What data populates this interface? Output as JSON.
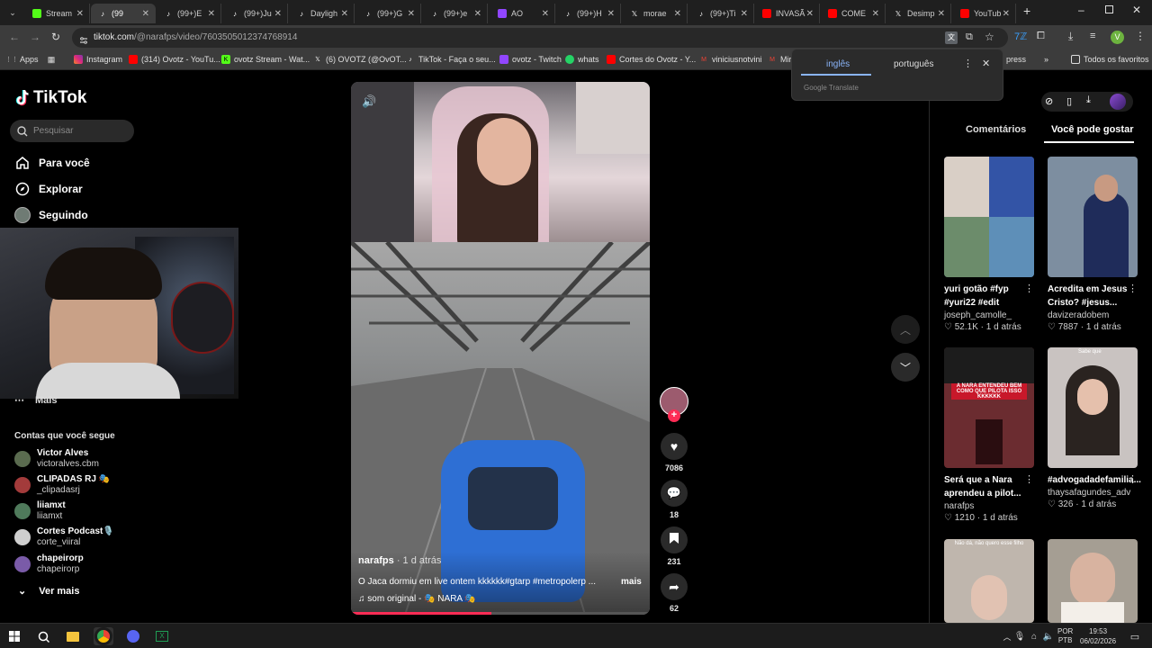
{
  "browser": {
    "tabs": [
      {
        "title": "Stream",
        "icon": "kick-icon",
        "color": "#53fc18"
      },
      {
        "title": "(99",
        "icon": "tiktok-icon",
        "color": "#ffffff",
        "active": true
      },
      {
        "title": "(99+)E",
        "icon": "tiktok-icon",
        "color": "#ffffff"
      },
      {
        "title": "(99+)Ju",
        "icon": "tiktok-icon",
        "color": "#ffffff"
      },
      {
        "title": "Dayligh",
        "icon": "tiktok-icon",
        "color": "#ffffff"
      },
      {
        "title": "(99+)G",
        "icon": "tiktok-icon",
        "color": "#ffffff"
      },
      {
        "title": "(99+)e",
        "icon": "tiktok-icon",
        "color": "#ffffff"
      },
      {
        "title": "AO",
        "icon": "twitch-icon",
        "color": "#9146ff"
      },
      {
        "title": "(99+)H",
        "icon": "tiktok-icon",
        "color": "#ffffff"
      },
      {
        "title": "morae",
        "icon": "x-icon",
        "color": "#ffffff"
      },
      {
        "title": "(99+)Ti",
        "icon": "tiktok-icon",
        "color": "#ffffff"
      },
      {
        "title": "INVASÃ",
        "icon": "youtube-icon",
        "color": "#ff0000"
      },
      {
        "title": "COME",
        "icon": "youtube-icon",
        "color": "#ff0000"
      },
      {
        "title": "Desimp",
        "icon": "x-icon",
        "color": "#ffffff"
      },
      {
        "title": "YouTub",
        "icon": "youtube-icon",
        "color": "#ff0000"
      }
    ],
    "url_host": "tiktok.com",
    "url_path": "/@narafps/video/7603505012374768914",
    "bookmarks": [
      {
        "label": "Apps",
        "icon": "apps-grid-icon"
      },
      {
        "label": "Instagram",
        "icon": "instagram-icon"
      },
      {
        "label": "(314) Ovotz - YouTu...",
        "icon": "youtube-icon"
      },
      {
        "label": "ovotz Stream - Wat...",
        "icon": "kick-icon"
      },
      {
        "label": "(6) OVOTZ (@OvOT...",
        "icon": "x-icon"
      },
      {
        "label": "TikTok - Faça o seu...",
        "icon": "tiktok-icon"
      },
      {
        "label": "ovotz - Twitch",
        "icon": "twitch-icon"
      },
      {
        "label": "whats",
        "icon": "whatsapp-icon"
      },
      {
        "label": "Cortes do Ovotz - Y...",
        "icon": "youtube-icon"
      },
      {
        "label": "viniciusnotvini",
        "icon": "gmail-icon"
      },
      {
        "label": "Mir",
        "icon": "gmail-icon"
      },
      {
        "label": "press",
        "icon": "folder-icon"
      },
      {
        "label": "Todos os favoritos",
        "icon": "folder-icon"
      }
    ],
    "translate": {
      "lang_a": "inglês",
      "lang_b": "português",
      "footer": "Google Translate"
    }
  },
  "sidebar": {
    "logo": "TikTok",
    "search_placeholder": "Pesquisar",
    "nav": [
      {
        "label": "Para você",
        "icon": "home-icon"
      },
      {
        "label": "Explorar",
        "icon": "compass-icon"
      },
      {
        "label": "Seguindo",
        "icon": "following-avatar-icon"
      }
    ],
    "more_label": "Mais",
    "following_title": "Contas que você segue",
    "accounts": [
      {
        "name": "Victor Alves",
        "handle": "victoralves.cbm",
        "color": "#5a6b4f"
      },
      {
        "name": "CLIPADAS RJ 🎭",
        "handle": "_clipadasrj",
        "color": "#a33b3b"
      },
      {
        "name": "liiamxt",
        "handle": "liiamxt",
        "color": "#4f7a5b"
      },
      {
        "name": "Cortes Podcast🎙️",
        "handle": "corte_viiral",
        "color": "#cfcfcf"
      },
      {
        "name": "chapeirorp",
        "handle": "chapeirorp",
        "color": "#7a5ba8"
      }
    ],
    "see_more": "Ver mais"
  },
  "video": {
    "author": "narafps",
    "age": "1 d atrás",
    "caption": "O Jaca dormiu em live ontem kkkkkk#gtarp #metropolerp ...",
    "more": "mais",
    "sound": "som original - 🎭 NARA 🎭",
    "progress": 0.47
  },
  "actions": [
    {
      "name": "like",
      "icon": "heart-icon",
      "count": "7086"
    },
    {
      "name": "comment",
      "icon": "comment-icon",
      "count": "18"
    },
    {
      "name": "bookmark",
      "icon": "bookmark-icon",
      "count": "231"
    },
    {
      "name": "share",
      "icon": "share-icon",
      "count": "62"
    }
  ],
  "right_panel": {
    "tab_comments": "Comentários",
    "tab_suggest": "Você pode gostar",
    "cards": [
      {
        "title": "yuri gotão #fyp #yuri22 #edit",
        "author": "joseph_camolle_",
        "likes": "52.1K",
        "age": "1 d atrás",
        "bg": "#4b6a86"
      },
      {
        "title": "Acredita em Jesus Cristo? #jesus...",
        "author": "davizeradobem",
        "likes": "7887",
        "age": "1 d atrás",
        "bg": "#7d8ea0"
      },
      {
        "title": "Será que a Nara aprendeu a pilot...",
        "author": "narafps",
        "likes": "1210",
        "age": "1 d atrás",
        "bg": "#6b2c30"
      },
      {
        "title": "#advogadadefamilia...",
        "author": "thaysafagundes_adv",
        "likes": "326",
        "age": "1 d atrás",
        "bg": "#c9c3c1"
      },
      {
        "title": "",
        "author": "",
        "likes": "",
        "age": "",
        "bg": "#bfb6ad"
      },
      {
        "title": "",
        "author": "",
        "likes": "",
        "age": "",
        "bg": "#a59e93"
      }
    ],
    "card_texts": {
      "c3_overlay": "A NARA ENTENDEU BEM COMO QUE PILOTA ISSO KKKKKK",
      "c4_overlay": "Sabe que",
      "c5_overlay": "Não dá, não quero esse filho"
    }
  },
  "taskbar": {
    "lang": "POR",
    "lang2": "PTB",
    "time": "19:53",
    "date": "06/02/2026"
  }
}
